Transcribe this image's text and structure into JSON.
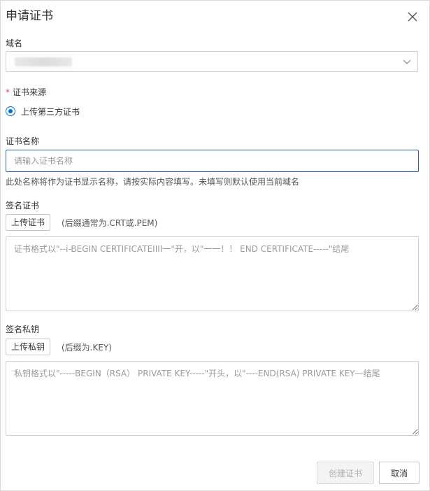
{
  "dialog": {
    "title": "申请证书",
    "close_icon": "close-icon"
  },
  "domain": {
    "label": "域名",
    "selected_value": "",
    "dropdown_icon": "chevron-down-icon"
  },
  "cert_source": {
    "required_mark": "*",
    "label": "证书来源",
    "option": "上传第三方证书",
    "selected": true
  },
  "cert_name": {
    "label": "证书名称",
    "value": "",
    "placeholder": "请输入证书名称",
    "help": "此处名称将作为证书显示名称，请按实际内容填写。未填写则默认使用当前域名"
  },
  "signed_cert": {
    "label": "签名证书",
    "upload_label": "上传证书",
    "hint": "(后缀通常为.CRT或.PEM)",
    "value": "",
    "placeholder": "证书格式以\"--i-BEGIN CERTIFICATEIIII一\"开，以\"一一！！ END CERTIFICATE-----\"结尾"
  },
  "private_key": {
    "label": "签名私钥",
    "upload_label": "上传私钥",
    "hint": "(后缀为.KEY)",
    "value": "",
    "placeholder": "私钥格式以\"-----BEGIN（RSA） PRIVATE KEY-----\"开头，以\"----END(RSA) PRIVATE KEY—结尾"
  },
  "footer": {
    "create_label": "创建证书",
    "cancel_label": "取消"
  },
  "colors": {
    "primary": "#0070cc",
    "focus_border": "#1f5fb4",
    "required": "#e5484d",
    "disabled_text": "#b0b0b0"
  }
}
